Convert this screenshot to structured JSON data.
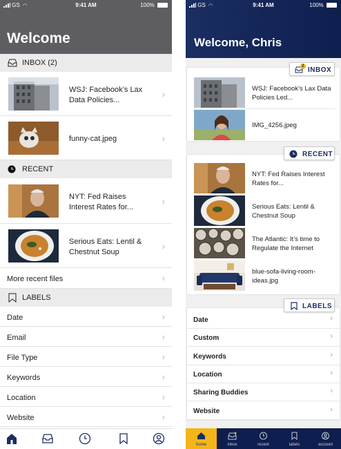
{
  "status_bar": {
    "carrier": "GS",
    "time": "9:41 AM",
    "battery": "100%"
  },
  "left": {
    "title": "Welcome",
    "inbox_header": "INBOX (2)",
    "inbox_items": [
      {
        "text": "WSJ: Facebook’s Lax Data Policies...",
        "thumb": "building-photo"
      },
      {
        "text": "funny-cat.jpeg",
        "thumb": "cat-photo"
      }
    ],
    "recent_header": "RECENT",
    "recent_items": [
      {
        "text": "NYT: Fed Raises Interest Rates for...",
        "thumb": "portrait-photo"
      },
      {
        "text": "Serious Eats: Lentil & Chestnut Soup",
        "thumb": "soup-photo"
      }
    ],
    "more_recent": "More recent files",
    "labels_header": "LABELS",
    "labels": [
      "Date",
      "Email",
      "File Type",
      "Keywords",
      "Location",
      "Website"
    ],
    "nav_icons": [
      "home-icon",
      "inbox-icon",
      "clock-icon",
      "bookmark-icon",
      "account-icon"
    ]
  },
  "right": {
    "title": "Welcome, Chris",
    "inbox_pill": "INBOX",
    "inbox_badge": "2",
    "inbox_items": [
      {
        "text": "WSJ: Facebook’s Lax Data Policies Led...",
        "thumb": "building-photo"
      },
      {
        "text": "IMG_4256.jpeg",
        "thumb": "selfie-photo"
      }
    ],
    "recent_pill": "RECENT",
    "recent_items": [
      {
        "text": "NYT: Fed Raises Interest Rates for...",
        "thumb": "portrait-photo"
      },
      {
        "text": "Serious Eats: Lentil & Chestnut Soup",
        "thumb": "soup-photo"
      },
      {
        "text": "The Atlantic: It’s time to Regulate the Internet",
        "thumb": "clocks-photo"
      },
      {
        "text": "blue-sofa-living-room-ideas.jpg",
        "thumb": "sofa-photo"
      }
    ],
    "labels_pill": "LABELS",
    "labels": [
      "Date",
      "Custom",
      "Keywords",
      "Location",
      "Sharing Buddies",
      "Website"
    ],
    "nav": [
      {
        "label": "home",
        "icon": "home-icon",
        "active": true
      },
      {
        "label": "inbox",
        "icon": "inbox-icon",
        "active": false
      },
      {
        "label": "recent",
        "icon": "clock-icon",
        "active": false
      },
      {
        "label": "labels",
        "icon": "bookmark-icon",
        "active": false
      },
      {
        "label": "account",
        "icon": "account-icon",
        "active": false
      }
    ]
  },
  "colors": {
    "left_header": "#5e5e62",
    "right_header": "#1b2e62",
    "accent_yellow": "#f4b51a"
  }
}
